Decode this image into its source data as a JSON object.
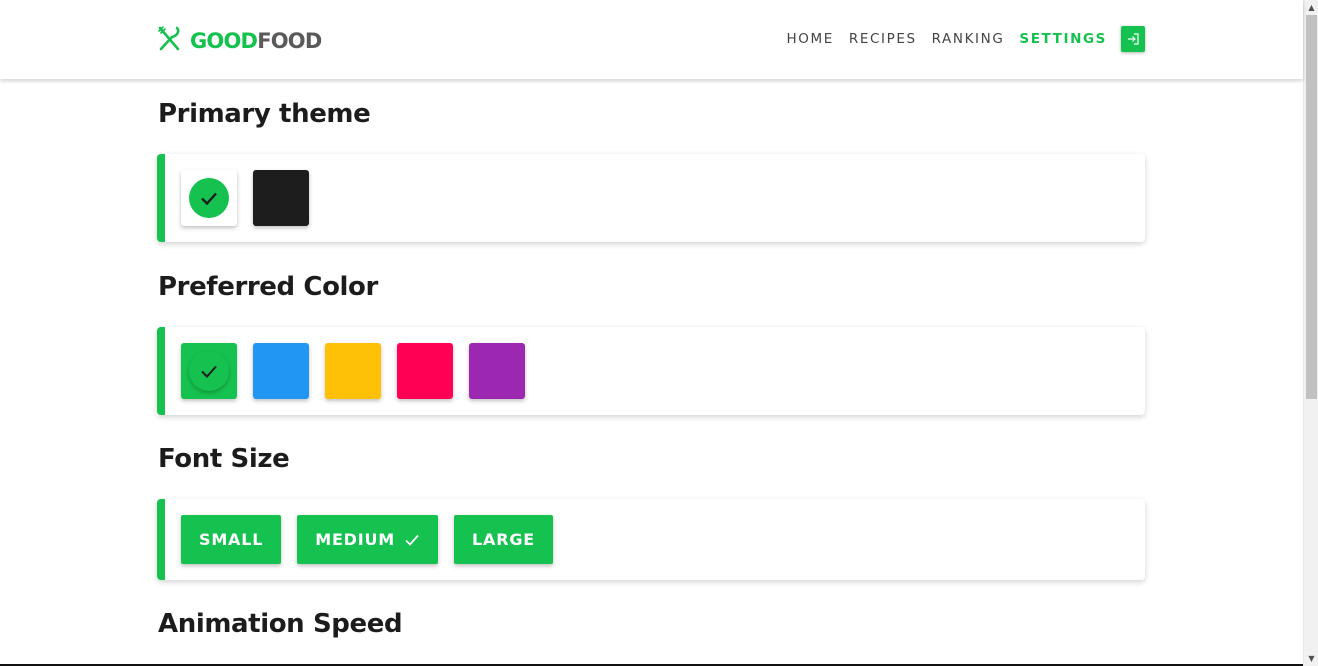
{
  "brand": {
    "name_part1": "GOOD",
    "name_part2": "FOOD",
    "logo_icon": "fork-knife-icon"
  },
  "nav": {
    "items": [
      {
        "label": "HOME",
        "active": false
      },
      {
        "label": "RECIPES",
        "active": false
      },
      {
        "label": "RANKING",
        "active": false
      },
      {
        "label": "SETTINGS",
        "active": true
      }
    ],
    "login_icon": "login-icon"
  },
  "sections": {
    "primary_theme": {
      "title": "Primary theme",
      "options": [
        {
          "name": "light",
          "color": "#ffffff",
          "selected": true
        },
        {
          "name": "dark",
          "color": "#1d1d1d",
          "selected": false
        }
      ]
    },
    "preferred_color": {
      "title": "Preferred Color",
      "options": [
        {
          "name": "green",
          "color": "#16c24f",
          "selected": true
        },
        {
          "name": "blue",
          "color": "#2196f3",
          "selected": false
        },
        {
          "name": "yellow",
          "color": "#ffc107",
          "selected": false
        },
        {
          "name": "pink",
          "color": "#ff0055",
          "selected": false
        },
        {
          "name": "purple",
          "color": "#9c27b0",
          "selected": false
        }
      ]
    },
    "font_size": {
      "title": "Font Size",
      "options": [
        {
          "label": "SMALL",
          "selected": false
        },
        {
          "label": "MEDIUM",
          "selected": true
        },
        {
          "label": "LARGE",
          "selected": false
        }
      ]
    },
    "animation_speed": {
      "title": "Animation Speed"
    }
  },
  "colors": {
    "accent": "#16c24f",
    "text_dark": "#1c1c1c",
    "nav_text": "#444444"
  }
}
